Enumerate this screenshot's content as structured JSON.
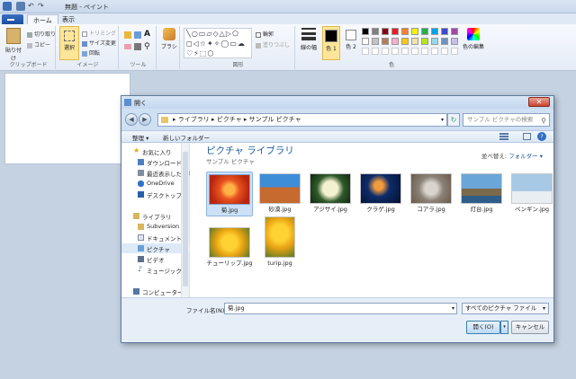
{
  "window": {
    "title": "無題 - ペイント"
  },
  "ribbon": {
    "tabs": [
      "ホーム",
      "表示"
    ],
    "clipboard": {
      "paste": "貼り付け",
      "cut": "切り取り",
      "copy": "コピー",
      "label": "クリップボード"
    },
    "image": {
      "select": "選択",
      "crop": "トリミング",
      "resize": "サイズ変更",
      "rotate": "回転",
      "label": "イメージ"
    },
    "tools": {
      "label": "ツール"
    },
    "brushes": {
      "label": "ブラシ"
    },
    "shapes": {
      "outline": "輪郭",
      "fill": "塗りつぶし",
      "label": "図形"
    },
    "colors": {
      "size": "線の幅",
      "color1": "色 1",
      "color2": "色 2",
      "edit": "色の編集",
      "label": "色"
    }
  },
  "palette": [
    "#000000",
    "#7f7f7f",
    "#880015",
    "#ed1c24",
    "#ff7f27",
    "#fff200",
    "#22b14c",
    "#00a2e8",
    "#3f48cc",
    "#a349a4",
    "#ffffff",
    "#c3c3c3",
    "#b97a57",
    "#ffaec9",
    "#ffc90e",
    "#efe4b0",
    "#b5e61d",
    "#99d9ea",
    "#7092be",
    "#c8bfe7"
  ],
  "dialog": {
    "title": "開く",
    "breadcrumb": [
      "ライブラリ",
      "ピクチャ",
      "サンプル ピクチャ"
    ],
    "search_placeholder": "サンプル ピクチャの検索",
    "commands": {
      "organize": "整理 ▾",
      "new_folder": "新しいフォルダー"
    },
    "nav": {
      "favorites": "お気に入り",
      "downloads": "ダウンロード",
      "recent": "最近表示した場所",
      "onedrive": "OneDrive",
      "desktop": "デスクトップ",
      "libraries": "ライブラリ",
      "subversion": "Subversion",
      "documents": "ドキュメント",
      "pictures": "ピクチャ",
      "videos": "ビデオ",
      "music": "ミュージック",
      "computer": "コンピューター"
    },
    "library": {
      "title": "ピクチャ ライブラリ",
      "subtitle": "サンプル ピクチャ",
      "arrange_label": "並べ替え:",
      "arrange_value": "フォルダー ▾"
    },
    "files": [
      "菊.jpg",
      "砂漠.jpg",
      "アジサイ.jpg",
      "クラゲ.jpg",
      "コアラ.jpg",
      "灯台.jpg",
      "ペンギン.jpg",
      "チューリップ.jpg",
      "turip.jpg"
    ],
    "filename_label": "ファイル名(N):",
    "filename_value": "菊.jpg",
    "filetype": "すべてのピクチャ ファイル",
    "open_button": "開く(O)",
    "cancel_button": "キャンセル"
  }
}
